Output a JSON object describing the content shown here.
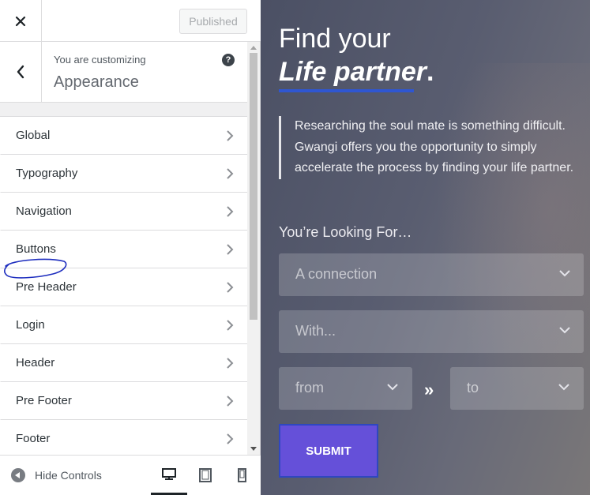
{
  "topbar": {
    "published_label": "Published"
  },
  "section": {
    "customizing_label": "You are customizing",
    "title": "Appearance",
    "help_symbol": "?"
  },
  "menu": {
    "items": [
      {
        "label": "Global"
      },
      {
        "label": "Typography"
      },
      {
        "label": "Navigation"
      },
      {
        "label": "Buttons"
      },
      {
        "label": "Pre Header"
      },
      {
        "label": "Login"
      },
      {
        "label": "Header"
      },
      {
        "label": "Pre Footer"
      },
      {
        "label": "Footer"
      }
    ]
  },
  "footer": {
    "hide_controls_label": "Hide Controls",
    "active_device": "desktop"
  },
  "preview": {
    "hero_line1": "Find your",
    "hero_line2": "Life partner",
    "hero_punct": ".",
    "quote": "Researching the soul mate is something difficult. Gwangi offers you the opportunity to simply accelerate the process by finding your life partner.",
    "looking_for_label": "You’re Looking For…",
    "select_connection": "A connection",
    "select_with": "With...",
    "select_from": "from",
    "range_separator": "»",
    "select_to": "to",
    "submit_label": "SUBMIT"
  },
  "colors": {
    "accent_underline": "#2f56d1",
    "submit_bg": "#6550d9",
    "annotation_ink": "#1f2fbf"
  },
  "icons": [
    "close-icon",
    "back-arrow-icon",
    "help-icon",
    "chevron-right-icon",
    "hide-controls-icon",
    "desktop-icon",
    "tablet-icon",
    "mobile-icon",
    "chevron-down-icon"
  ]
}
